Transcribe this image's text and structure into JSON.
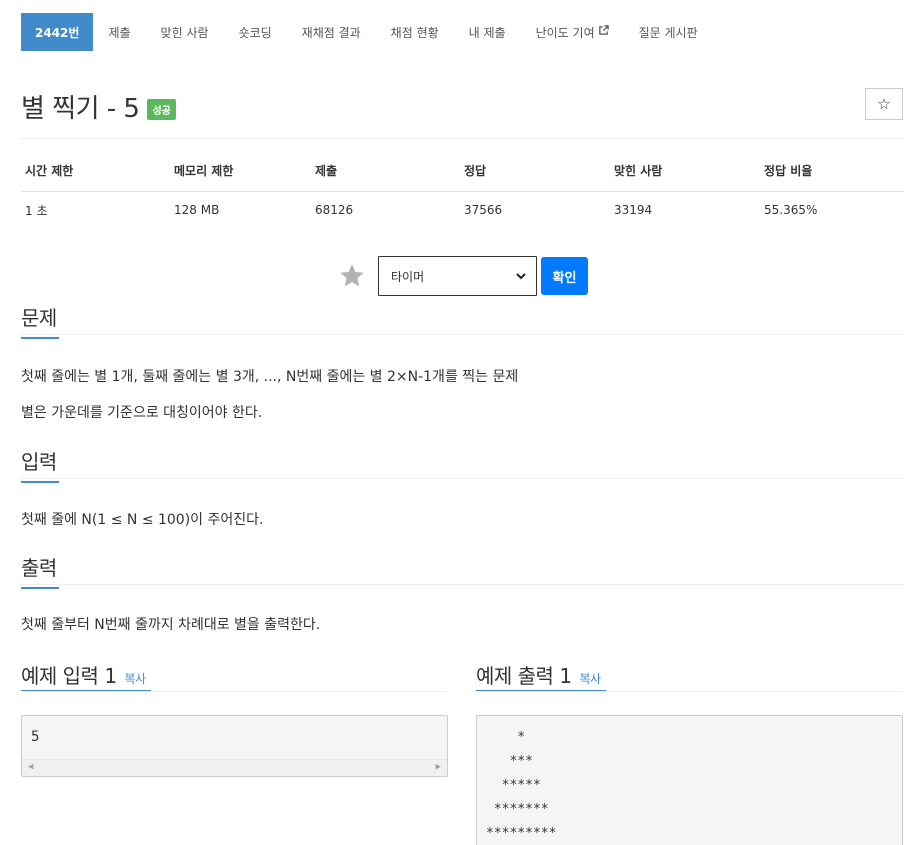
{
  "nav": {
    "items": [
      {
        "label": "2442번",
        "active": true
      },
      {
        "label": "제출"
      },
      {
        "label": "맞힌 사람"
      },
      {
        "label": "숏코딩"
      },
      {
        "label": "재채점 결과"
      },
      {
        "label": "채점 현황"
      },
      {
        "label": "내 제출"
      },
      {
        "label": "난이도 기여",
        "external": true
      },
      {
        "label": "질문 게시판"
      }
    ]
  },
  "problem": {
    "title": "별 찍기 - 5",
    "badge": "성공",
    "star_button": "☆"
  },
  "stats": {
    "headers": [
      "시간 제한",
      "메모리 제한",
      "제출",
      "정답",
      "맞힌 사람",
      "정답 비율"
    ],
    "values": [
      "1 초",
      "128 MB",
      "68126",
      "37566",
      "33194",
      "55.365%"
    ]
  },
  "timer": {
    "select_value": "타이머",
    "confirm_label": "확인"
  },
  "sections": {
    "description": {
      "heading": "문제",
      "lines": [
        "첫째 줄에는 별 1개, 둘째 줄에는 별 3개, ..., N번째 줄에는 별 2×N-1개를 찍는 문제",
        "별은 가운데를 기준으로 대칭이어야 한다."
      ]
    },
    "input": {
      "heading": "입력",
      "text": "첫째 줄에 N(1 ≤ N ≤ 100)이 주어진다."
    },
    "output": {
      "heading": "출력",
      "text": "첫째 줄부터 N번째 줄까지 차례대로 별을 출력한다."
    }
  },
  "examples": {
    "input": {
      "heading": "예제 입력 1",
      "copy_label": "복사",
      "value": "5"
    },
    "output": {
      "heading": "예제 출력 1",
      "copy_label": "복사",
      "lines": [
        "    *",
        "   ***",
        "  *****",
        " *******",
        "*********"
      ]
    }
  },
  "colors": {
    "accent": "#428bca",
    "success": "#5cb85c",
    "primary_button": "#007bff"
  }
}
